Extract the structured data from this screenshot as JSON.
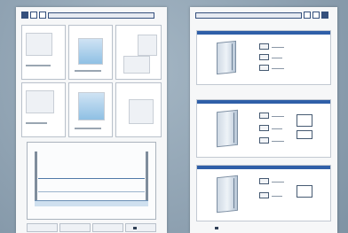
{
  "left_page": {
    "header": {
      "title": ""
    },
    "big_figure_caption": ""
  },
  "right_page": {
    "header": {
      "title": ""
    },
    "products": [
      {
        "title": "",
        "options": 3
      },
      {
        "title": "",
        "options": 3
      },
      {
        "title": "",
        "options": 2
      }
    ]
  },
  "colors": {
    "brand_blue": "#2f5fa8",
    "header_navy": "#35507d",
    "background": "#8fa3b3"
  }
}
